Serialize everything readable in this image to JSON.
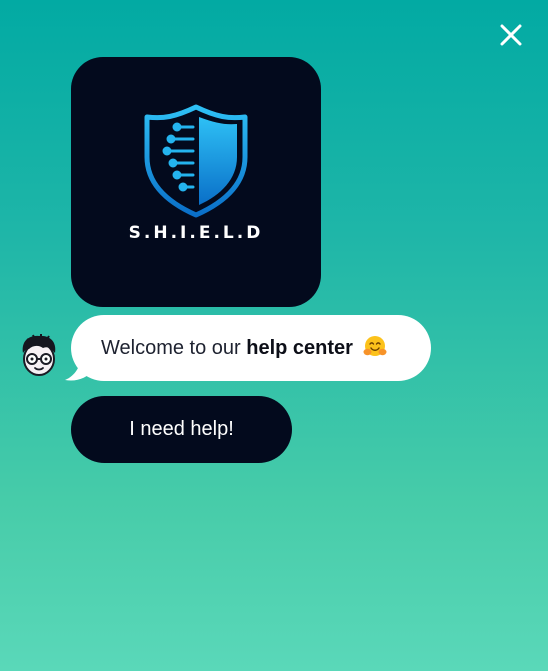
{
  "close": {
    "icon": "close-icon"
  },
  "logo": {
    "icon": "shield-circuit-icon",
    "text": "S.H.I.E.L.D",
    "colors": {
      "background": "#030a1d",
      "shield_light": "#24b4ef",
      "shield_dark": "#0a6fc8"
    }
  },
  "avatar": {
    "icon": "cartoon-face-with-glasses-icon"
  },
  "message": {
    "prefix": "Welcome to our ",
    "bold": "help center",
    "emoji": "hugging-face-emoji"
  },
  "actions": {
    "help_label": "I need help!"
  },
  "theme": {
    "gradient_top": "#02aaa3",
    "gradient_bottom": "#5ad8b9",
    "dark": "#030a1d"
  }
}
